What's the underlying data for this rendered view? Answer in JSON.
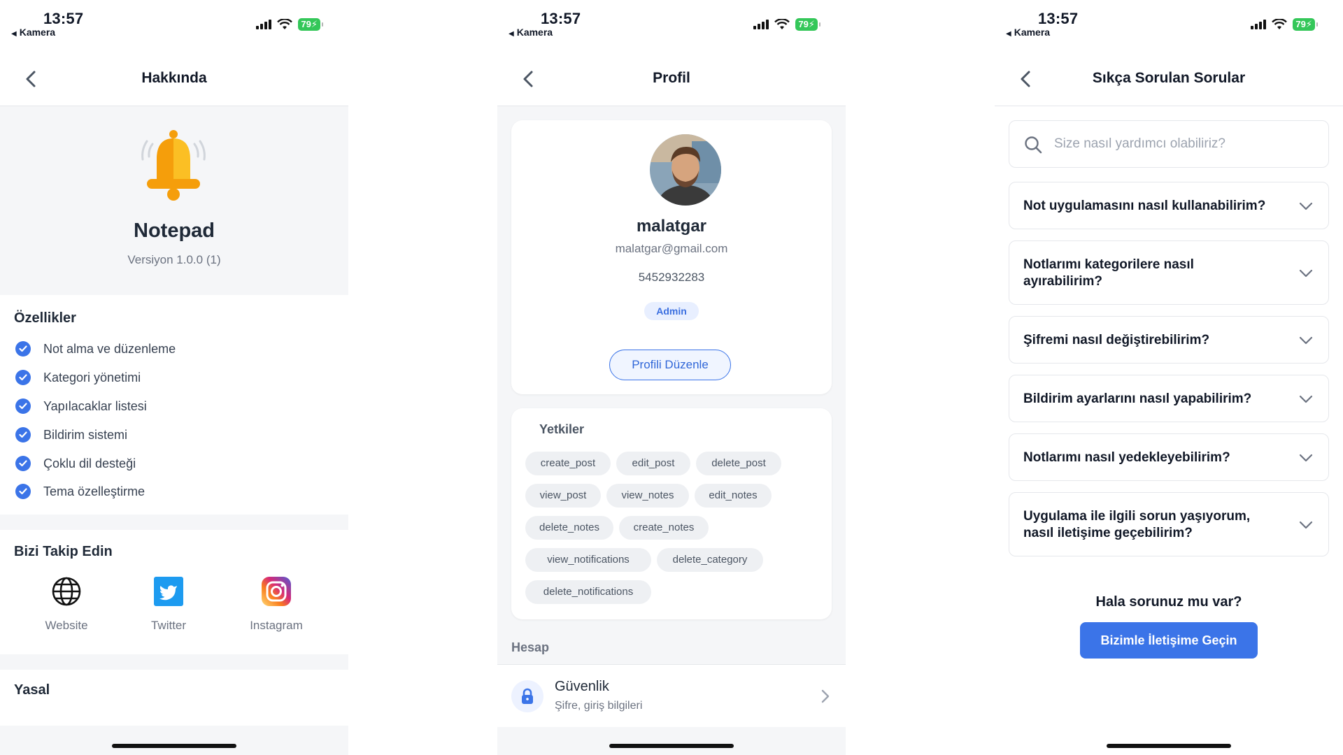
{
  "status_bar": {
    "time": "13:57",
    "back_app": "Kamera",
    "battery": "79"
  },
  "about": {
    "nav_title": "Hakkında",
    "app_name": "Notepad",
    "version": "Versiyon 1.0.0 (1)",
    "features_title": "Özellikler",
    "features": [
      "Not alma ve düzenleme",
      "Kategori yönetimi",
      "Yapılacaklar listesi",
      "Bildirim sistemi",
      "Çoklu dil desteği",
      "Tema özelleştirme"
    ],
    "follow_title": "Bizi Takip Edin",
    "social": [
      {
        "label": "Website",
        "icon": "globe-icon"
      },
      {
        "label": "Twitter",
        "icon": "twitter-icon"
      },
      {
        "label": "Instagram",
        "icon": "instagram-icon"
      }
    ],
    "legal_title": "Yasal"
  },
  "profile": {
    "nav_title": "Profil",
    "username": "malatgar",
    "email": "malatgar@gmail.com",
    "phone": "5452932283",
    "role": "Admin",
    "edit_button": "Profili Düzenle",
    "permissions_title": "Yetkiler",
    "permissions": [
      "create_post",
      "edit_post",
      "delete_post",
      "view_post",
      "view_notes",
      "edit_notes",
      "delete_notes",
      "create_notes",
      "view_notifications",
      "delete_category",
      "delete_notifications"
    ],
    "account_title": "Hesap",
    "security": {
      "title": "Güvenlik",
      "subtitle": "Şifre, giriş bilgileri"
    }
  },
  "faq": {
    "nav_title": "Sıkça Sorulan Sorular",
    "search_placeholder": "Size nasıl yardımcı olabiliriz?",
    "questions": [
      "Not uygulamasını nasıl kullanabilirim?",
      "Notlarımı kategorilere nasıl ayırabilirim?",
      "Şifremi nasıl değiştirebilirim?",
      "Bildirim ayarlarını nasıl yapabilirim?",
      "Notlarımı nasıl yedekleyebilirim?",
      "Uygulama ile ilgili sorun yaşıyorum, nasıl iletişime geçebilirim?"
    ],
    "help_text": "Hala sorunuz mu var?",
    "contact_button": "Bizimle İletişime Geçin"
  },
  "colors": {
    "accent": "#3b74e8",
    "battery": "#34c759",
    "background_soft": "#f5f6f8"
  }
}
